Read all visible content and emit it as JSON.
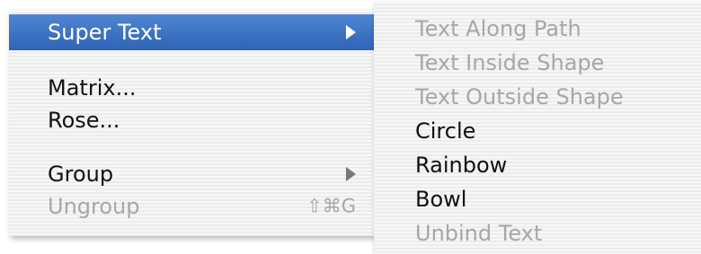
{
  "main_menu": {
    "items": [
      {
        "label": "Super Text",
        "state": "highlighted",
        "has_submenu": true,
        "arrow_icon": "triangle-right-icon"
      },
      {
        "label": "Matrix...",
        "state": "enabled"
      },
      {
        "label": "Rose...",
        "state": "enabled"
      },
      {
        "label": "Group",
        "state": "enabled",
        "has_submenu": true,
        "arrow_icon": "triangle-right-icon"
      },
      {
        "label": "Ungroup",
        "state": "disabled",
        "shortcut": "⇧⌘G"
      }
    ]
  },
  "sub_menu": {
    "items": [
      {
        "label": "Text Along Path",
        "state": "disabled"
      },
      {
        "label": "Text Inside Shape",
        "state": "disabled"
      },
      {
        "label": "Text Outside Shape",
        "state": "disabled"
      },
      {
        "label": "Circle",
        "state": "enabled"
      },
      {
        "label": "Rainbow",
        "state": "enabled"
      },
      {
        "label": "Bowl",
        "state": "enabled"
      },
      {
        "label": "Unbind Text",
        "state": "disabled"
      }
    ]
  },
  "colors": {
    "highlight": "#3b72c4",
    "enabled_text": "#111111",
    "disabled_text": "#a7a7a7",
    "menu_background": "#f4f4f4"
  }
}
